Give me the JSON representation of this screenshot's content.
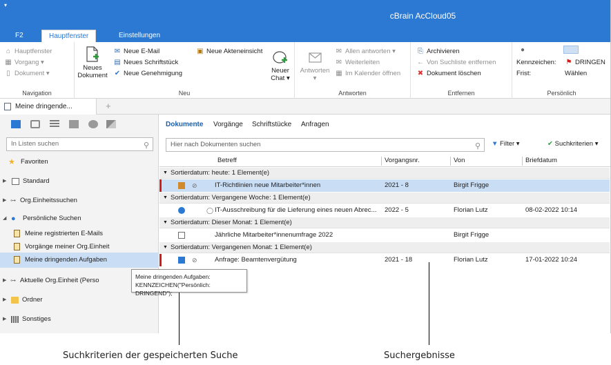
{
  "window": {
    "title": "cBrain AcCloud05",
    "system_menu": "▾"
  },
  "ribbon_tabs": [
    {
      "label": "F2",
      "active": false
    },
    {
      "label": "Hauptfenster",
      "active": true
    },
    {
      "label": "Einstellungen",
      "active": false
    }
  ],
  "ribbon": {
    "navigation": {
      "items": [
        "Hauptfenster",
        "Vorgang ▾",
        "Dokument ▾"
      ],
      "label": "Navigation"
    },
    "neu": {
      "neues_dokument": "Neues Dokument",
      "items": [
        "Neue E-Mail",
        "Neues Schriftstück",
        "Neue Genehmigung"
      ],
      "akteneinsicht": "Neue Akteneinsicht",
      "neuer_chat": "Neuer Chat ▾",
      "label": "Neu"
    },
    "antworten": {
      "antworten_btn": "Antworten ▾",
      "items": [
        "Allen antworten ▾",
        "Weiterleiten",
        "Im Kalender öffnen"
      ],
      "label": "Antworten"
    },
    "entfernen": {
      "items": [
        "Archivieren",
        "Von Suchliste entfernen",
        "Dokument löschen"
      ],
      "label": "Entfernen"
    },
    "persoenlich": {
      "kennzeichen_label": "Kennzeichen:",
      "kennzeichen_value": "DRINGEN",
      "frist_label": "Frist:",
      "frist_value": "Wählen",
      "label": "Persönlich"
    }
  },
  "doc_tab": {
    "label": "Meine dringende...",
    "add": "+"
  },
  "left": {
    "search_placeholder": "In Listen suchen",
    "tree": [
      {
        "label": "Favoriten"
      },
      {
        "label": "Standard"
      },
      {
        "label": "Org.Einheitssuchen"
      },
      {
        "label": "Persönliche Suchen"
      },
      {
        "label": "Meine registrierten E-Mails"
      },
      {
        "label": "Vorgänge meiner Org.Einheit"
      },
      {
        "label": "Meine dringenden Aufgaben"
      },
      {
        "label": "Aktuelle Org.Einheit (Perso"
      },
      {
        "label": "Ordner"
      },
      {
        "label": "Sonstiges"
      }
    ],
    "tooltip": {
      "line1": "Meine dringenden Aufgaben:",
      "line2": "KENNZEICHEN(\"Persönlich: DRINGEND\");"
    }
  },
  "right": {
    "subtabs": [
      "Dokumente",
      "Vorgänge",
      "Schriftstücke",
      "Anfragen"
    ],
    "search_placeholder": "Hier nach Dokumenten suchen",
    "filter_label": "Filter ▾",
    "criteria_label": "Suchkriterien ▾",
    "columns": [
      "Betreff",
      "Vorgangsnr.",
      "Von",
      "Briefdatum"
    ],
    "groups": [
      {
        "header": "Sortierdatum: heute: 1 Element(e)",
        "rows": [
          {
            "subject": "IT-Richtlinien neue Mitarbeiter*innen",
            "number": "2021 - 8",
            "from": "Birgit Frigge",
            "date": "",
            "flag": true,
            "selected": true,
            "status": "task",
            "attachment": true
          }
        ]
      },
      {
        "header": "Sortierdatum: Vergangene Woche: 1 Element(e)",
        "rows": [
          {
            "subject": "IT-Ausschreibung für die Lieferung eines neuen Abrec...",
            "number": "2022 - 5",
            "from": "Florian Lutz",
            "date": "08-02-2022 10:14",
            "flag": false,
            "selected": false,
            "status": "done",
            "attachment": false,
            "chat": true
          }
        ]
      },
      {
        "header": "Sortierdatum: Dieser Monat: 1 Element(e)",
        "rows": [
          {
            "subject": "Jährliche Mitarbeiter*innenumfrage 2022",
            "number": "",
            "from": "Birgit Frigge",
            "date": "",
            "flag": false,
            "selected": false,
            "status": "doc",
            "attachment": false
          }
        ]
      },
      {
        "header": "Sortierdatum: Vergangenen Monat: 1 Element(e)",
        "rows": [
          {
            "subject": "Anfrage: Beamtenvergütung",
            "number": "2021 - 18",
            "from": "Florian Lutz",
            "date": "17-01-2022 10:24",
            "flag": true,
            "selected": false,
            "status": "checked",
            "attachment": true
          }
        ]
      }
    ]
  },
  "callouts": {
    "left": "Suchkriterien der gespeicherten Suche",
    "right": "Suchergebnisse"
  },
  "colors": {
    "accent": "#2b79d3",
    "selection": "#c9def5",
    "flag": "#d61a1a"
  }
}
